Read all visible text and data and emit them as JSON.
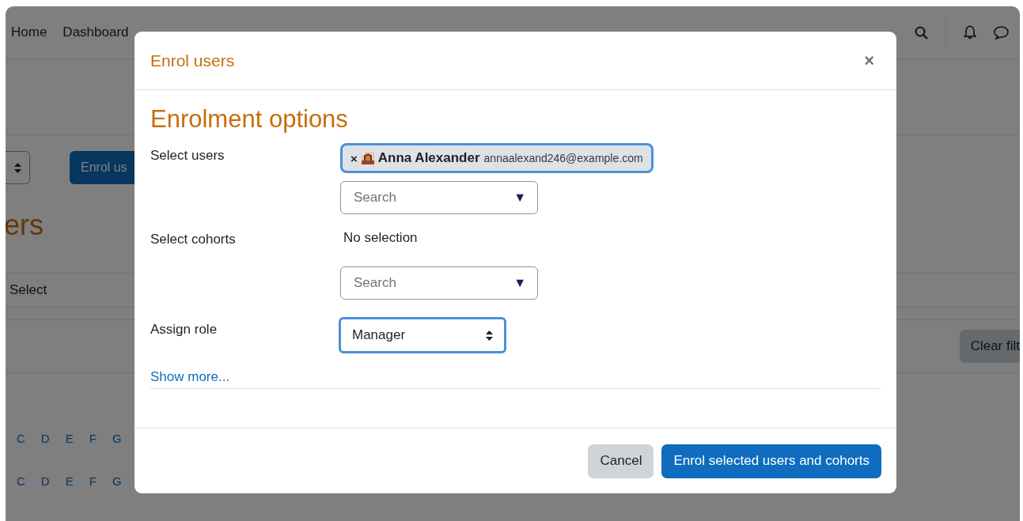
{
  "background_page": {
    "nav_links": [
      "Home",
      "Dashboard"
    ],
    "enrol_button": "Enrol us",
    "heading": "ers",
    "select_label": "Select",
    "clear_button": "Clear filt",
    "letter_rows": [
      [
        "C",
        "D",
        "E",
        "F",
        "G"
      ],
      [
        "C",
        "D",
        "E",
        "F",
        "G"
      ]
    ]
  },
  "modal": {
    "title": "Enrol users",
    "close": "×",
    "section_title": "Enrolment options",
    "fields": [
      {
        "kind": "autocomplete",
        "label": "Select users",
        "selection": [
          {
            "name": "Anna Alexander",
            "email": "annaalexand246@example.com",
            "remove": "×",
            "focused": true
          }
        ],
        "placeholder": "Search",
        "arrow": "▼"
      },
      {
        "kind": "autocomplete",
        "label": "Select cohorts",
        "empty_text": "No selection",
        "placeholder": "Search",
        "arrow": "▼"
      },
      {
        "kind": "select",
        "label": "Assign role",
        "value": "Manager",
        "focused": true
      }
    ],
    "show_more": "Show more...",
    "buttons": [
      {
        "label": "Cancel",
        "kind": "secondary"
      },
      {
        "label": "Enrol selected users and cohorts",
        "kind": "primary"
      }
    ]
  }
}
